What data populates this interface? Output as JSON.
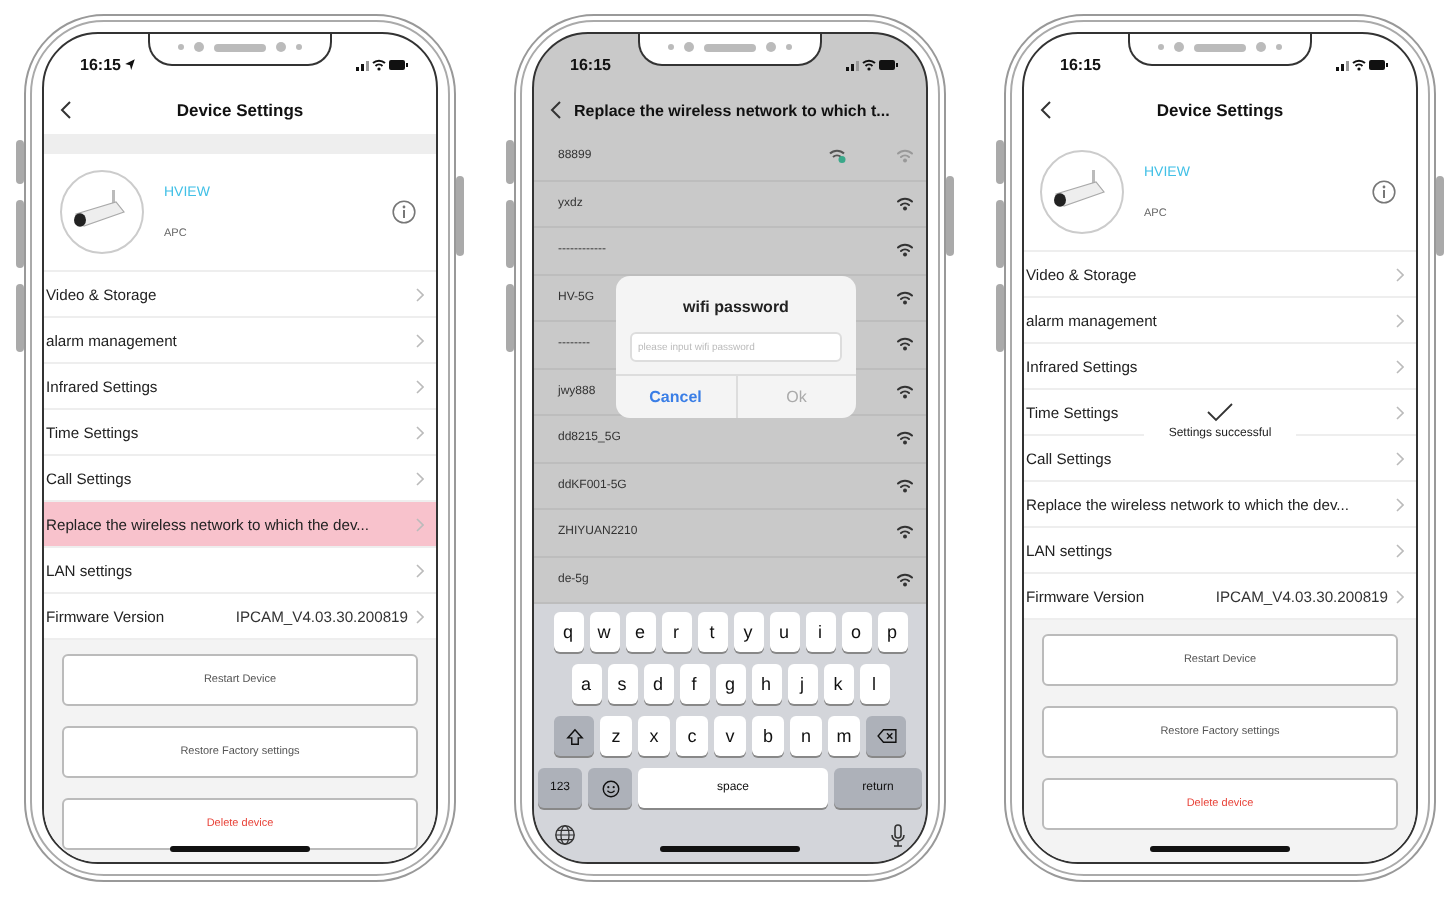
{
  "phones": [
    {
      "kind": "settings",
      "status": {
        "time": "16:15",
        "location": true
      },
      "nav": {
        "title": "Device Settings"
      },
      "top_band": true,
      "device": {
        "name": "HVIEW",
        "model": "APC"
      },
      "rows": [
        {
          "label": "Video & Storage",
          "selected": false
        },
        {
          "label": "alarm management",
          "selected": false
        },
        {
          "label": "Infrared Settings",
          "selected": false
        },
        {
          "label": "Time Settings",
          "selected": false
        },
        {
          "label": "Call Settings",
          "selected": false
        },
        {
          "label": "Replace the wireless network to which the dev...",
          "selected": true
        },
        {
          "label": "LAN settings",
          "selected": false
        },
        {
          "label": "Firmware Version",
          "value": "IPCAM_V4.03.30.200819",
          "selected": false
        }
      ],
      "buttons": [
        {
          "label": "Restart Device",
          "kind": "normal"
        },
        {
          "label": "Restore Factory settings",
          "kind": "normal"
        },
        {
          "label": "Delete device",
          "kind": "danger"
        }
      ]
    },
    {
      "kind": "wifi",
      "status": {
        "time": "16:15",
        "location": false
      },
      "nav": {
        "title": "Replace the wireless network to which t..."
      },
      "networks": [
        {
          "name": "88899",
          "connected": true
        },
        {
          "name": "yxdz",
          "connected": false
        },
        {
          "name": "------------",
          "connected": false
        },
        {
          "name": "HV-5G",
          "connected": false
        },
        {
          "name": "--------",
          "connected": false
        },
        {
          "name": "jwy888",
          "connected": false
        },
        {
          "name": "dd8215_5G",
          "connected": false
        },
        {
          "name": "ddKF001-5G",
          "connected": false
        },
        {
          "name": "ZHIYUAN2210",
          "connected": false
        },
        {
          "name": "de-5g",
          "connected": false
        }
      ],
      "dialog": {
        "title": "wifi password",
        "placeholder": "please input wifi password",
        "buttons": [
          {
            "label": "Cancel",
            "disabled": false
          },
          {
            "label": "Ok",
            "disabled": true
          }
        ]
      },
      "keyboard": {
        "rows": [
          [
            "q",
            "w",
            "e",
            "r",
            "t",
            "y",
            "u",
            "i",
            "o",
            "p"
          ],
          [
            "a",
            "s",
            "d",
            "f",
            "g",
            "h",
            "j",
            "k",
            "l"
          ],
          [
            "z",
            "x",
            "c",
            "v",
            "b",
            "n",
            "m"
          ]
        ],
        "numbers": "123",
        "space": "space",
        "return": "return"
      }
    },
    {
      "kind": "settings",
      "status": {
        "time": "16:15",
        "location": false
      },
      "nav": {
        "title": "Device Settings"
      },
      "top_band": false,
      "device": {
        "name": "HVIEW",
        "model": "APC"
      },
      "rows": [
        {
          "label": "Video & Storage",
          "selected": false
        },
        {
          "label": "alarm management",
          "selected": false
        },
        {
          "label": "Infrared Settings",
          "selected": false
        },
        {
          "label": "Time Settings",
          "selected": false
        },
        {
          "label": "Call Settings",
          "selected": false
        },
        {
          "label": "Replace the wireless network to which the dev...",
          "selected": false
        },
        {
          "label": "LAN settings",
          "selected": false
        },
        {
          "label": "Firmware Version",
          "value": "IPCAM_V4.03.30.200819",
          "selected": false
        }
      ],
      "buttons": [
        {
          "label": "Restart Device",
          "kind": "normal"
        },
        {
          "label": "Restore Factory settings",
          "kind": "normal"
        },
        {
          "label": "Delete device",
          "kind": "danger"
        }
      ],
      "toast": {
        "text": "Settings successful"
      }
    }
  ]
}
